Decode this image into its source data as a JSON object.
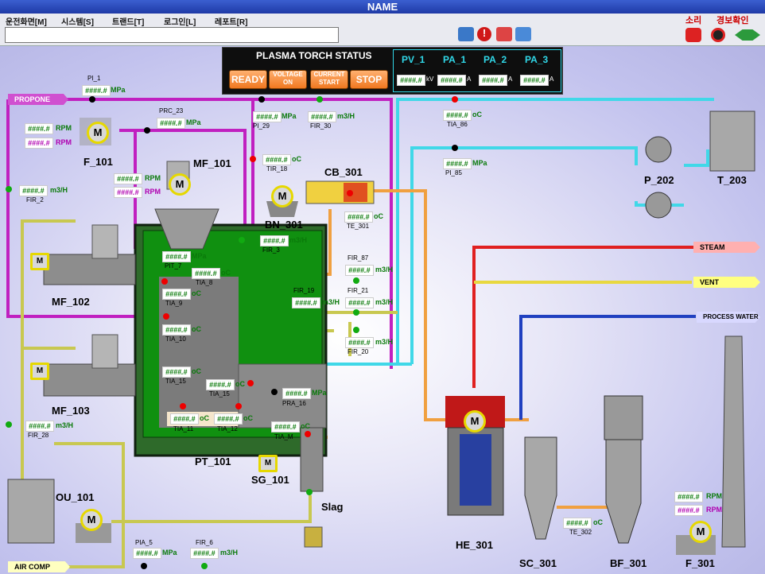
{
  "window": {
    "title": "NAME"
  },
  "menu": [
    "운전화면[M]",
    "시스템[S]",
    "트랜드[T]",
    "로그인[L]",
    "레포트[R]"
  ],
  "toolbar": {
    "sound_label": "소리",
    "alarm_confirm_label": "경보확인"
  },
  "plasma": {
    "title": "PLASMA TORCH STATUS",
    "buttons": {
      "ready": "READY",
      "voltage_on_1": "VOLTAGE",
      "voltage_on_2": "ON",
      "current_start_1": "CURRENT",
      "current_start_2": "START",
      "stop": "STOP"
    },
    "headers": [
      "PV_1",
      "PA_1",
      "PA_2",
      "PA_3"
    ],
    "values": [
      "####.#",
      "####.#",
      "####.#",
      "####.#"
    ],
    "units": [
      "kV",
      "A",
      "A",
      "A"
    ]
  },
  "streams": {
    "propone": "PROPONE",
    "steam": "STEAM",
    "vent": "VENT",
    "process_water": "PROCESS WATER",
    "air_comp": "AIR COMP",
    "slag": "Slag"
  },
  "equipment": {
    "f101": "F_101",
    "mf101": "MF_101",
    "mf102": "MF_102",
    "mf103": "MF_103",
    "bn301": "BN_301",
    "cb301": "CB_301",
    "pt101": "PT_101",
    "sg101": "SG_101",
    "ou101": "OU_101",
    "he301": "HE_301",
    "sc301": "SC_301",
    "bf301": "BF_301",
    "f301": "F_301",
    "p202": "P_202",
    "t203": "T_203"
  },
  "readout": "####.#",
  "units": {
    "mpa": "MPa",
    "rpm": "RPM",
    "m3h": "m3/H",
    "oc": "oC"
  },
  "tags": {
    "pi1": "PI_1",
    "prc23": "PRC_23",
    "pi29": "PI_29",
    "fir30": "FIR_30",
    "tia86": "TIA_86",
    "pi85": "PI_85",
    "fir2": "FIR_2",
    "tir18": "TIR_18",
    "te301a": "TE_301",
    "fir3": "FIR_3",
    "fir87": "FIR_87",
    "fir19": "FIR_19",
    "fir21": "FIR_21",
    "fir20": "FIR_20",
    "pit": "PIT_7",
    "tia8": "TIA_8",
    "tia9": "TIA_9",
    "tia10": "TIA_10",
    "tia15a": "TIA_15",
    "tia15b": "TIA_15",
    "pra16": "PRA_16",
    "tia11": "TIA_11",
    "tia12": "TIA_12",
    "tiam": "TIA_M",
    "fir28": "FIR_28",
    "pia5": "PIA_5",
    "fir6": "FIR_6",
    "te302": "TE_302"
  },
  "motor_label": "M",
  "colors": {
    "magenta": "#c020c0",
    "cyan": "#40d8e8",
    "orange": "#f0a040",
    "red": "#e02020",
    "blue": "#2040c0",
    "olive": "#c8c850"
  }
}
